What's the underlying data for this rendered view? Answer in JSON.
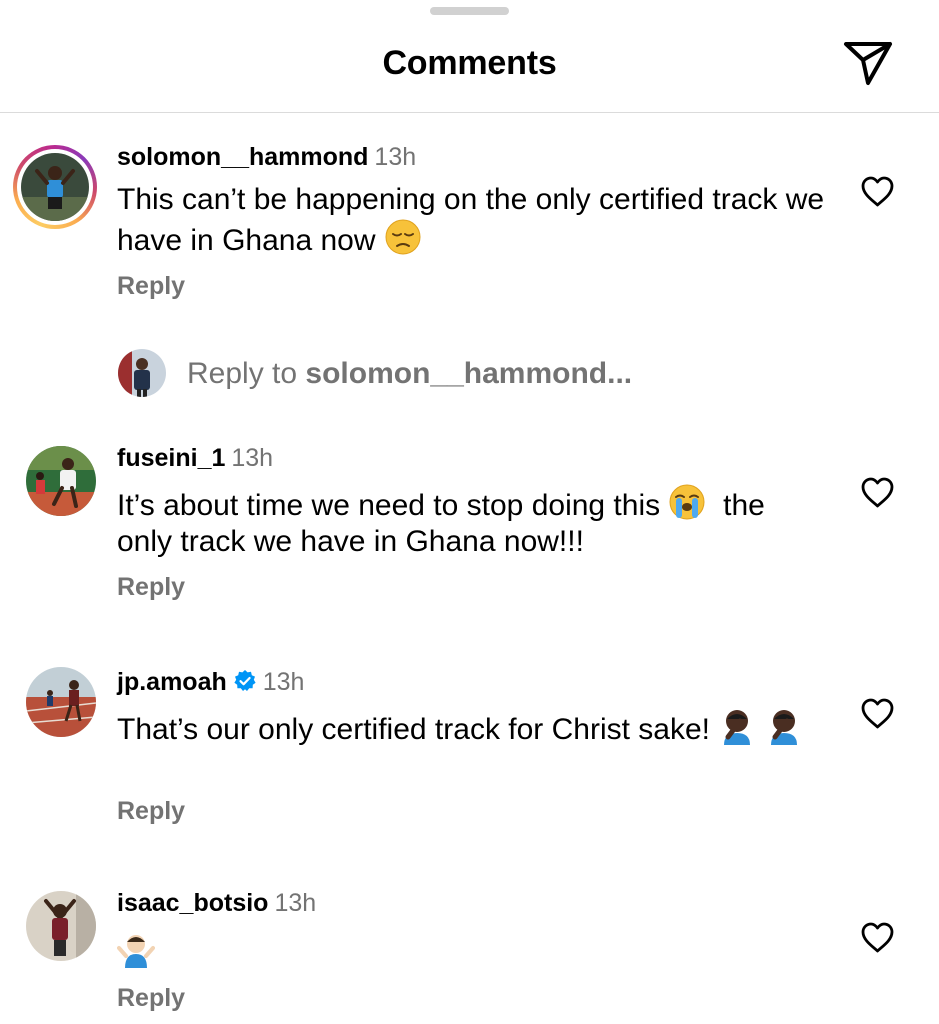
{
  "header": {
    "title": "Comments",
    "share_icon": "paper-plane-icon"
  },
  "comments": [
    {
      "username": "solomon__hammond",
      "time": "13h",
      "text": "This can’t be happening on the only certified track we have in Ghana now",
      "emoji": "pensive-face",
      "reply_label": "Reply",
      "has_story_ring": true
    },
    {
      "username": "fuseini_1",
      "time": "13h",
      "text_before": "It’s about time we need to stop doing this",
      "emoji": "loudly-crying-face",
      "text_after": "the only track we have in Ghana now!!!",
      "reply_label": "Reply"
    },
    {
      "username": "jp.amoah",
      "verified": true,
      "time": "13h",
      "text": "That’s our only certified track for Christ sake!",
      "emoji": "man-facepalming-dark-skin-tone",
      "emoji_count": 2,
      "reply_label": "Reply"
    },
    {
      "username": "isaac_botsio",
      "time": "13h",
      "emoji": "man-shrugging",
      "reply_label": "Reply"
    }
  ],
  "reply_prompt": {
    "prefix": "Reply to",
    "target": "solomon__hammond..."
  },
  "colors": {
    "accent_blue": "#0095f6",
    "secondary_text": "#737373",
    "divider": "#dbdbdb"
  }
}
